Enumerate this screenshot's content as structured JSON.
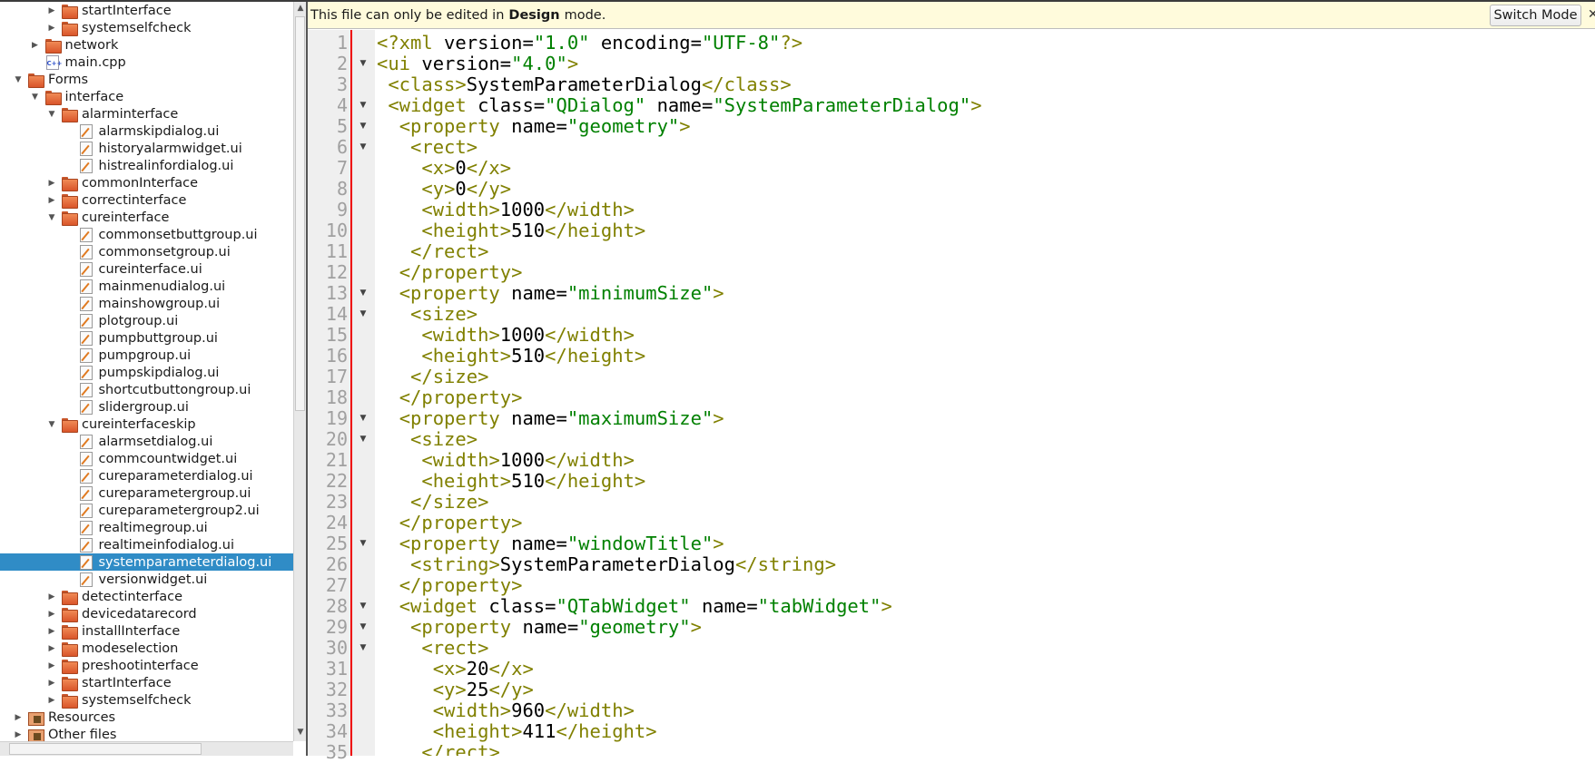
{
  "tree": [
    {
      "label": "startInterface",
      "level": 3,
      "type": "folder",
      "state": "collapsed"
    },
    {
      "label": "systemselfcheck",
      "level": 3,
      "type": "folder",
      "state": "collapsed"
    },
    {
      "label": "network",
      "level": 2,
      "type": "folder",
      "state": "collapsed"
    },
    {
      "label": "main.cpp",
      "level": 2,
      "type": "cpp",
      "state": "leaf"
    },
    {
      "label": "Forms",
      "level": 1,
      "type": "folder",
      "state": "expanded"
    },
    {
      "label": "interface",
      "level": 2,
      "type": "folder",
      "state": "expanded"
    },
    {
      "label": "alarminterface",
      "level": 3,
      "type": "folder",
      "state": "expanded"
    },
    {
      "label": "alarmskipdialog.ui",
      "level": 4,
      "type": "file",
      "state": "leaf"
    },
    {
      "label": "historyalarmwidget.ui",
      "level": 4,
      "type": "file",
      "state": "leaf"
    },
    {
      "label": "histrealinfordialog.ui",
      "level": 4,
      "type": "file",
      "state": "leaf"
    },
    {
      "label": "commonInterface",
      "level": 3,
      "type": "folder",
      "state": "collapsed"
    },
    {
      "label": "correctinterface",
      "level": 3,
      "type": "folder",
      "state": "collapsed"
    },
    {
      "label": "cureinterface",
      "level": 3,
      "type": "folder",
      "state": "expanded"
    },
    {
      "label": "commonsetbuttgroup.ui",
      "level": 4,
      "type": "file",
      "state": "leaf"
    },
    {
      "label": "commonsetgroup.ui",
      "level": 4,
      "type": "file",
      "state": "leaf"
    },
    {
      "label": "cureinterface.ui",
      "level": 4,
      "type": "file",
      "state": "leaf"
    },
    {
      "label": "mainmenudialog.ui",
      "level": 4,
      "type": "file",
      "state": "leaf"
    },
    {
      "label": "mainshowgroup.ui",
      "level": 4,
      "type": "file",
      "state": "leaf"
    },
    {
      "label": "plotgroup.ui",
      "level": 4,
      "type": "file",
      "state": "leaf"
    },
    {
      "label": "pumpbuttgroup.ui",
      "level": 4,
      "type": "file",
      "state": "leaf"
    },
    {
      "label": "pumpgroup.ui",
      "level": 4,
      "type": "file",
      "state": "leaf"
    },
    {
      "label": "pumpskipdialog.ui",
      "level": 4,
      "type": "file",
      "state": "leaf"
    },
    {
      "label": "shortcutbuttongroup.ui",
      "level": 4,
      "type": "file",
      "state": "leaf"
    },
    {
      "label": "slidergroup.ui",
      "level": 4,
      "type": "file",
      "state": "leaf"
    },
    {
      "label": "cureinterfaceskip",
      "level": 3,
      "type": "folder",
      "state": "expanded"
    },
    {
      "label": "alarmsetdialog.ui",
      "level": 4,
      "type": "file",
      "state": "leaf"
    },
    {
      "label": "commcountwidget.ui",
      "level": 4,
      "type": "file",
      "state": "leaf"
    },
    {
      "label": "cureparameterdialog.ui",
      "level": 4,
      "type": "file",
      "state": "leaf"
    },
    {
      "label": "cureparametergroup.ui",
      "level": 4,
      "type": "file",
      "state": "leaf"
    },
    {
      "label": "cureparametergroup2.ui",
      "level": 4,
      "type": "file",
      "state": "leaf"
    },
    {
      "label": "realtimegroup.ui",
      "level": 4,
      "type": "file",
      "state": "leaf"
    },
    {
      "label": "realtimeinfodialog.ui",
      "level": 4,
      "type": "file",
      "state": "leaf"
    },
    {
      "label": "systemparameterdialog.ui",
      "level": 4,
      "type": "file",
      "state": "leaf",
      "selected": true
    },
    {
      "label": "versionwidget.ui",
      "level": 4,
      "type": "file",
      "state": "leaf"
    },
    {
      "label": "detectinterface",
      "level": 3,
      "type": "folder",
      "state": "collapsed"
    },
    {
      "label": "devicedatarecord",
      "level": 3,
      "type": "folder",
      "state": "collapsed"
    },
    {
      "label": "installInterface",
      "level": 3,
      "type": "folder",
      "state": "collapsed"
    },
    {
      "label": "modeselection",
      "level": 3,
      "type": "folder",
      "state": "collapsed"
    },
    {
      "label": "preshootinterface",
      "level": 3,
      "type": "folder",
      "state": "collapsed"
    },
    {
      "label": "startInterface",
      "level": 3,
      "type": "folder",
      "state": "collapsed"
    },
    {
      "label": "systemselfcheck",
      "level": 3,
      "type": "folder",
      "state": "collapsed"
    },
    {
      "label": "Resources",
      "level": 1,
      "type": "special",
      "state": "collapsed"
    },
    {
      "label": "Other files",
      "level": 1,
      "type": "special",
      "state": "collapsed"
    }
  ],
  "infobar": {
    "text_before": "This file can only be edited in",
    "text_bold": "Design",
    "text_after": "mode.",
    "switch_label": "Switch Mode",
    "close_glyph": "✕"
  },
  "colors": {
    "tag": "#808000",
    "value": "#008000",
    "selection": "#308cc6",
    "marker": "#e00000",
    "infobar": "#fffbdc"
  },
  "editor": {
    "fold_lines": [
      2,
      4,
      5,
      6,
      13,
      14,
      19,
      20,
      25,
      28,
      29,
      30
    ],
    "lines": [
      "<?xml version=\"1.0\" encoding=\"UTF-8\"?>",
      "<ui version=\"4.0\">",
      " <class>SystemParameterDialog</class>",
      " <widget class=\"QDialog\" name=\"SystemParameterDialog\">",
      "  <property name=\"geometry\">",
      "   <rect>",
      "    <x>0</x>",
      "    <y>0</y>",
      "    <width>1000</width>",
      "    <height>510</height>",
      "   </rect>",
      "  </property>",
      "  <property name=\"minimumSize\">",
      "   <size>",
      "    <width>1000</width>",
      "    <height>510</height>",
      "   </size>",
      "  </property>",
      "  <property name=\"maximumSize\">",
      "   <size>",
      "    <width>1000</width>",
      "    <height>510</height>",
      "   </size>",
      "  </property>",
      "  <property name=\"windowTitle\">",
      "   <string>SystemParameterDialog</string>",
      "  </property>",
      "  <widget class=\"QTabWidget\" name=\"tabWidget\">",
      "   <property name=\"geometry\">",
      "    <rect>",
      "     <x>20</x>",
      "     <y>25</y>",
      "     <width>960</width>",
      "     <height>411</height>",
      "    </rect>"
    ]
  }
}
